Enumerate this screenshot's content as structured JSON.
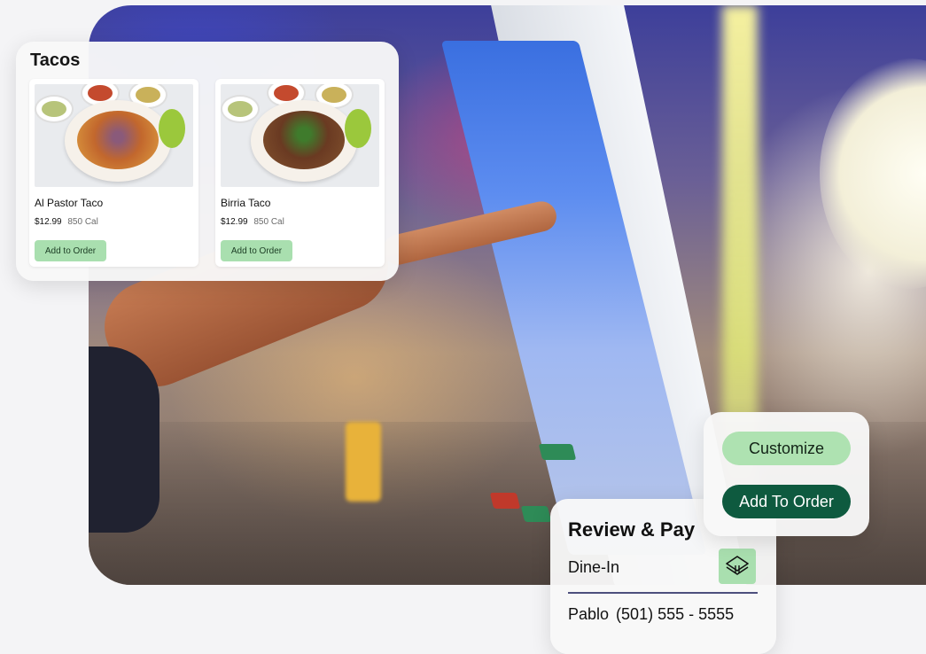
{
  "menu": {
    "category_title": "Tacos",
    "items": [
      {
        "name": "Al Pastor Taco",
        "price": "$12.99",
        "calories": "850 Cal",
        "add_label": "Add to Order"
      },
      {
        "name": "Birria Taco",
        "price": "$12.99",
        "calories": "850 Cal",
        "add_label": "Add to Order"
      }
    ]
  },
  "actions": {
    "customize_label": "Customize",
    "add_to_order_label": "Add To Order"
  },
  "review": {
    "title": "Review & Pay",
    "order_type": "Dine-In",
    "order_type_icon": "dine-in-tray-icon",
    "customer_name": "Pablo",
    "customer_phone": "(501) 555 - 5555"
  },
  "colors": {
    "accent_light_green": "#a9dfaf",
    "accent_dark_green": "#0e5a3f",
    "divider": "#4d4f7d"
  }
}
